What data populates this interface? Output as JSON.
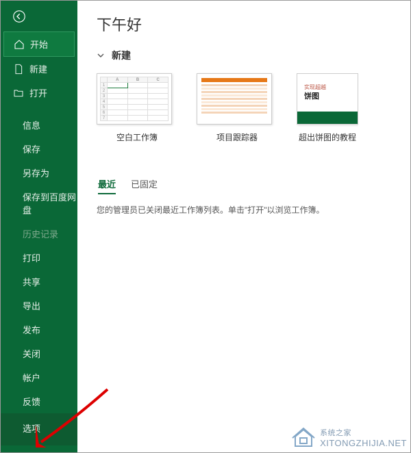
{
  "sidebar": {
    "items": [
      {
        "label": "开始",
        "icon": "home-icon"
      },
      {
        "label": "新建",
        "icon": "document-icon"
      },
      {
        "label": "打开",
        "icon": "folder-icon"
      },
      {
        "label": "信息"
      },
      {
        "label": "保存"
      },
      {
        "label": "另存为"
      },
      {
        "label": "保存到百度网盘"
      },
      {
        "label": "历史记录"
      },
      {
        "label": "打印"
      },
      {
        "label": "共享"
      },
      {
        "label": "导出"
      },
      {
        "label": "发布"
      },
      {
        "label": "关闭"
      }
    ],
    "bottom": [
      {
        "label": "帐户"
      },
      {
        "label": "反馈"
      },
      {
        "label": "选项"
      }
    ]
  },
  "main": {
    "greeting": "下午好",
    "new_section": "新建",
    "templates": [
      {
        "label": "空白工作簿"
      },
      {
        "label": "项目跟踪器"
      },
      {
        "label": "超出饼图的教程"
      }
    ],
    "pie_text1": "实现超越",
    "pie_text2": "饼图",
    "tabs": [
      {
        "label": "最近",
        "active": true
      },
      {
        "label": "已固定",
        "active": false
      }
    ],
    "message": "您的管理员已关闭最近工作簿列表。单击\"打开\"以浏览工作簿。"
  },
  "watermark": {
    "cn": "系统之家",
    "en": "XITONGZHIJIA.NET"
  }
}
